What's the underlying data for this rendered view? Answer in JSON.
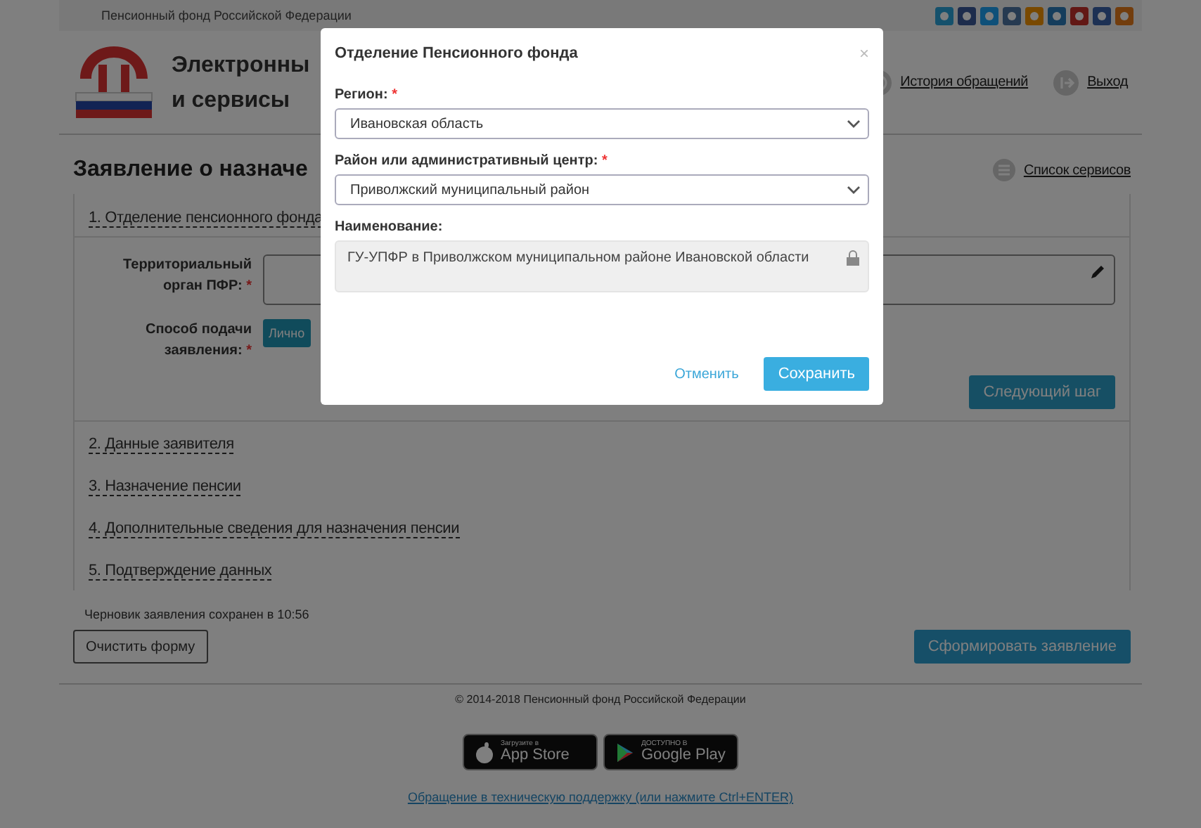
{
  "top_bar": {
    "org": "Пенсионный фонд Российской Федерации"
  },
  "header": {
    "title_lines": [
      "Электронны",
      "и сервисы"
    ],
    "links": [
      {
        "label": "История обращений",
        "kind": "history"
      },
      {
        "label": "Выход",
        "kind": "exit"
      }
    ]
  },
  "page": {
    "title": "Заявление о назначе",
    "services_link": "Список сервисов"
  },
  "steps": [
    {
      "label": "1. Отделение пенсионного фонда",
      "form": {
        "fields": [
          {
            "label": "Территориальный орган ПФР:",
            "mark": "*",
            "kind": "text"
          },
          {
            "label": "Способ подачи заявления:",
            "mark": "*",
            "kind": "choice",
            "option": "Лично"
          }
        ],
        "next_button": "Следующий шаг"
      }
    },
    {
      "label": "2. Данные заявителя"
    },
    {
      "label": "3. Назначение пенсии"
    },
    {
      "label": "4. Дополнительные сведения для назначения пенсии"
    },
    {
      "label": "5. Подтверждение данных"
    }
  ],
  "draft_note": "Черновик заявления сохранен в 10:56",
  "clear_button": "Очистить форму",
  "submit_button": "Сформировать заявление",
  "footer": {
    "copyright": "© 2014-2018 Пенсионный фонд Российской Федерации",
    "badges": [
      {
        "kind": "apple",
        "small": "Загрузите в",
        "big": "App Store"
      },
      {
        "kind": "google",
        "small": "ДОСТУПНО В",
        "big": "Google Play"
      }
    ],
    "support_link": "Обращение в техническую поддержку (или нажмите Ctrl+ENTER)"
  },
  "modal": {
    "title": "Отделение Пенсионного фонда",
    "close": "×",
    "fields": [
      {
        "label": "Регион:",
        "mark": "*",
        "kind": "select",
        "value": "Ивановская область"
      },
      {
        "label": "Район или административный центр:",
        "mark": "*",
        "kind": "select",
        "value": "Приволжский муниципальный район"
      },
      {
        "label": "Наименование:",
        "kind": "locked",
        "value": "ГУ-УПФР в Приволжском муниципальном районе Ивановской области"
      }
    ],
    "buttons": [
      {
        "label": "Отменить",
        "kind": "link"
      },
      {
        "label": "Сохранить",
        "kind": "primary"
      }
    ]
  }
}
